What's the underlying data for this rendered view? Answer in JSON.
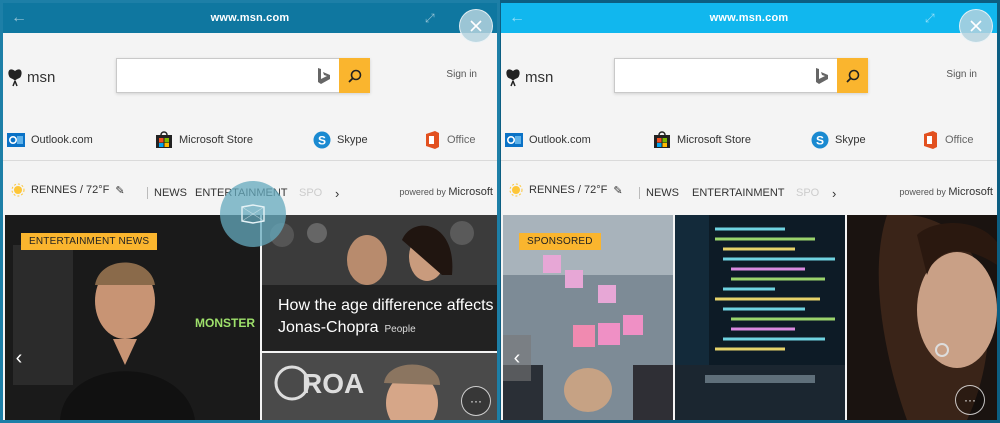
{
  "left_window": {
    "url": "www.msn.com",
    "brand": "msn",
    "signin": "Sign in",
    "quicklinks": [
      "Outlook.com",
      "Microsoft Store",
      "Skype",
      "Office"
    ],
    "weather": "RENNES / 72°F",
    "nav": [
      "NEWS",
      "ENTERTAINMENT",
      "SPO"
    ],
    "powered_by": "powered by",
    "powered_brand": "Microsoft",
    "tag": "ENTERTAINMENT NEWS",
    "headline": "How the age difference affects Jonas-Chopra",
    "headline_source": "People"
  },
  "right_window": {
    "url": "www.msn.com",
    "brand": "msn",
    "signin": "Sign in",
    "quicklinks": [
      "Outlook.com",
      "Microsoft Store",
      "Skype",
      "Office"
    ],
    "weather": "RENNES / 72°F",
    "nav": [
      "NEWS",
      "ENTERTAINMENT",
      "SPO"
    ],
    "powered_by": "powered by",
    "powered_brand": "Microsoft",
    "tag": "SPONSORED"
  },
  "colors": {
    "accent": "#fab52e",
    "left_titlebar": "#0f77a0",
    "right_titlebar": "#11b7ee",
    "outlook": "#0a72c6",
    "skype": "#1a8ad1",
    "office": "#e2501f"
  },
  "icons": {
    "back": "arrow-left-icon",
    "close": "close-icon",
    "search": "search-icon",
    "bing": "bing-icon",
    "weather": "sun-icon",
    "edit": "pencil-icon",
    "more": "ellipsis-icon"
  }
}
